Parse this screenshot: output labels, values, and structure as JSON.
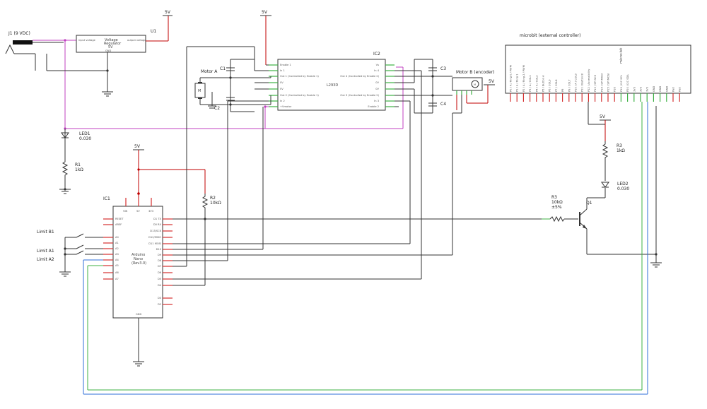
{
  "labels": {
    "j1": "J1 (9 VDC)",
    "u1": "U1",
    "reg_title1": "Voltage",
    "reg_title2": "Regulator",
    "reg_title3": "5V",
    "reg_in": "input voltage",
    "reg_out": "output voltage",
    "reg_gnd": "GND",
    "v5_u1": "5V",
    "v5_ic2": "5V",
    "v5_motorb": "5V",
    "v5_nano": "5V",
    "v5_r3": "5V",
    "ic2": "IC2",
    "l293d": "L293D",
    "c1": "C1",
    "c2": "C2",
    "c3": "C3",
    "c4": "C4",
    "motor_a": "Motor A",
    "motor_b": "Motor B (encoder)",
    "motor_symbol": "M",
    "led1": "LED1",
    "led1_val": "0.030",
    "r1": "R1",
    "r1_val": "1kΩ",
    "r2": "R2",
    "r2_val": "10kΩ",
    "r3_top": "R3",
    "r3_top_val": "1kΩ",
    "led2": "LED2",
    "led2_val": "0.030",
    "r3_mid": "R3",
    "r3_mid_val1": "10kΩ",
    "r3_mid_val2": "±5%",
    "q1": "Q1",
    "ic1": "IC1",
    "nano1": "Arduino",
    "nano2": "Nano",
    "nano3": "(Rev3.0)",
    "limit_b1": "Limit B1",
    "limit_a1": "Limit A1",
    "limit_a2": "Limit A2",
    "microbit": "microbit (external controller)",
    "microbit_logo": "micro:bit"
  },
  "ic2_left_pins": [
    "Enable 1",
    "In 1",
    "Out 1 (Controlled by Enable 1)",
    "0V",
    "0V",
    "Out 2 (Controlled by Enable 1)",
    "In 2",
    "+Vmotor"
  ],
  "ic2_right_pins": [
    "Vs",
    "In 4",
    "Out 4 (Controlled by Enable 2)",
    "0V",
    "0V",
    "Out 3 (Controlled by Enable 2)",
    "In 3",
    "Enable 2"
  ],
  "nano_left_pins": [
    "RESET",
    "AREF",
    "A0",
    "A1",
    "A2",
    "A3",
    "A4",
    "A5",
    "A6",
    "A7"
  ],
  "nano_right_pins": [
    "D1 TX",
    "D0 RX",
    "D13/SCK",
    "D12/MISO",
    "D11 MOSI",
    "D10",
    "D9",
    "D8",
    "D7",
    "D6",
    "D5",
    "D4",
    "D3",
    "D2"
  ],
  "nano_top_pins": [
    "VIN",
    "5V",
    "3V3"
  ],
  "nano_bottom_pin": "GND",
  "microbit_pins": [
    "P0 / A / Ring 0 / PWM",
    "P1 / A / Ring 1",
    "P2 / A / Ring 2 / PWM",
    "P3 / A / COL1",
    "P4 / A / COL2",
    "P5 / Button A",
    "P6 / COL9",
    "P7 / COL8",
    "P8",
    "P9 / COL7",
    "P10 / A / COL3",
    "P11 / Button B",
    "P12 / Accessibility",
    "P13 / SPI SCK",
    "P14 / SPI MISO",
    "P15 / SPI MOSI",
    "P16",
    "P19 / I2C SCL",
    "P20 / I2C SDA",
    "3V3",
    "3V3",
    "3V3",
    "GND",
    "GND",
    "GND",
    "Pad",
    "Pad"
  ]
}
